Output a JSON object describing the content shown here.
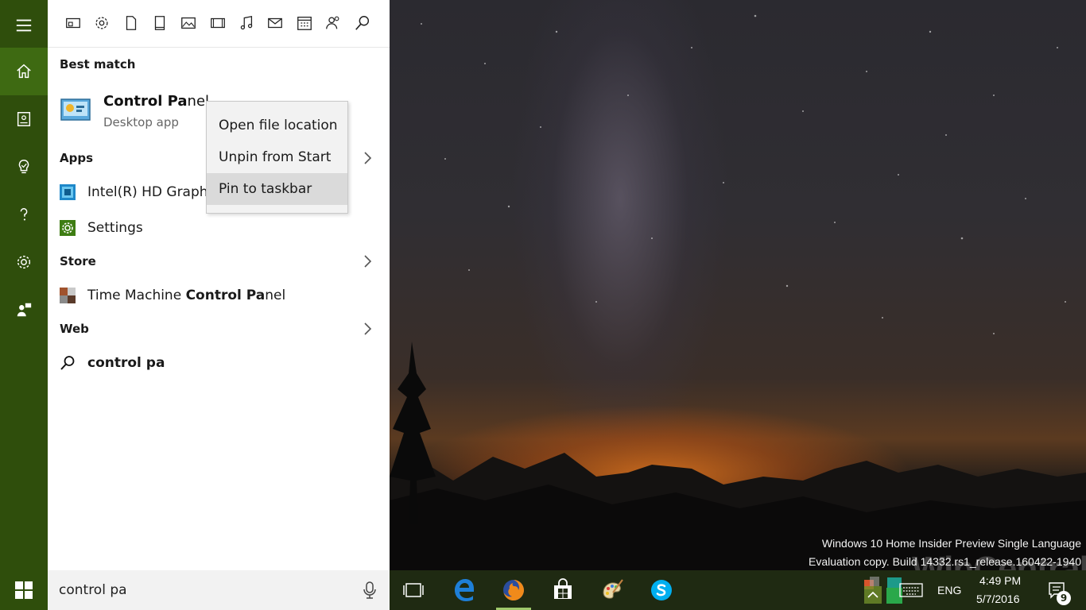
{
  "rail": {
    "items": [
      {
        "name": "menu-icon"
      },
      {
        "name": "home-icon",
        "active": true
      },
      {
        "name": "notebook-icon"
      },
      {
        "name": "lightbulb-icon"
      },
      {
        "name": "help-icon"
      },
      {
        "name": "settings-icon"
      },
      {
        "name": "feedback-icon"
      }
    ]
  },
  "filters": [
    "apps-filter-icon",
    "settings-filter-icon",
    "documents-filter-icon",
    "folders-filter-icon",
    "photos-filter-icon",
    "videos-filter-icon",
    "music-filter-icon",
    "email-filter-icon",
    "calendar-filter-icon",
    "people-filter-icon",
    "web-filter-icon"
  ],
  "results": {
    "best_match_header": "Best match",
    "best_match": {
      "title_bold": "Control Pa",
      "title_rest": "nel",
      "subtitle": "Desktop app"
    },
    "apps_header": "Apps",
    "apps": [
      {
        "label": "Intel(R) HD Graphi"
      },
      {
        "label": "Settings"
      }
    ],
    "store_header": "Store",
    "store_item": {
      "prefix": "Time Machine ",
      "bold": "Control Pa",
      "suffix": "nel"
    },
    "web_header": "Web",
    "web_item": {
      "bold": "control pa"
    }
  },
  "context_menu": {
    "items": [
      "Open file location",
      "Unpin from Start",
      "Pin to taskbar"
    ],
    "highlighted_index": 2
  },
  "search": {
    "value": "control pa"
  },
  "watermark": {
    "line1": "Windows 10 Home Insider Preview Single Language",
    "line2": "Evaluation copy. Build 14332.rs1_release.160422-1940"
  },
  "brand_overlay": "WinCentral",
  "tray": {
    "language": "ENG",
    "time": "4:49 PM",
    "date": "5/7/2016",
    "notification_count": "9"
  },
  "colors": {
    "accent": "#2f4e0c",
    "accent_active": "#3e6a12",
    "running_indicator": "#9fc86b"
  }
}
